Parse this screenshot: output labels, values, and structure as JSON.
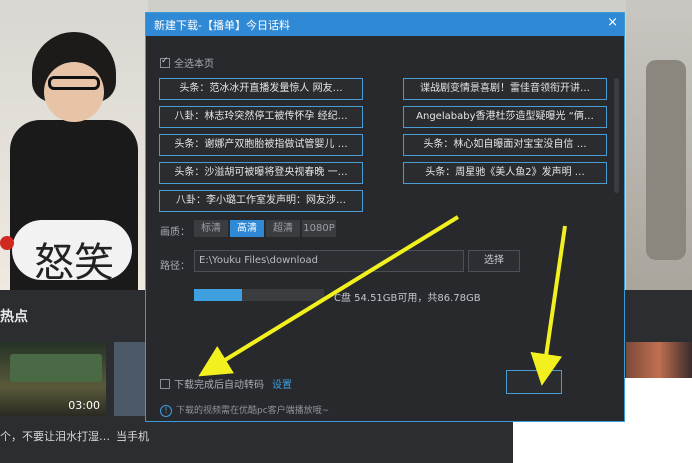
{
  "background": {
    "calligraphy": "怒笑",
    "hot_section_title": "热点",
    "thumbs": [
      {
        "caption": "个，不要让泪水打湿…",
        "duration": "03:00"
      },
      {
        "caption": "当手机",
        "duration": ""
      }
    ]
  },
  "dialog": {
    "title": "新建下载-【播单】今日话料",
    "close_label": "×",
    "select_all_label": "全选本页",
    "select_all_checked": true,
    "items_left": [
      "头条：范冰冰开直播发量惊人  网友…",
      "八卦：林志玲突然停工被传怀孕  经纪…",
      "头条：谢娜产双胞胎被指做试管婴儿 …",
      "头条：沙溢胡可被曝将登央视春晚  一…",
      "八卦：李小璐工作室发声明：网友涉…"
    ],
    "items_right": [
      "谍战剧变情景喜剧！雷佳音领衔开讲…",
      "Angelababy香港杜莎造型疑曝光 “俩…",
      "头条：林心如自曝面对宝宝没自信  …",
      "头条：周星驰《美人鱼2》发声明  …"
    ],
    "quality": {
      "label": "画质：",
      "options": [
        "标清",
        "高清",
        "超清",
        "1080P"
      ],
      "selected": "高清"
    },
    "path": {
      "label": "路径：",
      "value": "E:\\Youku Files\\download",
      "choose_label": "选择"
    },
    "disk": {
      "text": "C盘 54.51GB可用，共86.78GB",
      "used_fraction": 0.37,
      "accent": "#3fa0e0"
    },
    "auto_transcode_label": "下载完成后自动转码",
    "settings_link": "设置",
    "note": "下载的视频需在优酷pc客户端播放哦~",
    "colors": {
      "title_bar": "#2f89d5",
      "arrow": "#f2f01e"
    }
  }
}
